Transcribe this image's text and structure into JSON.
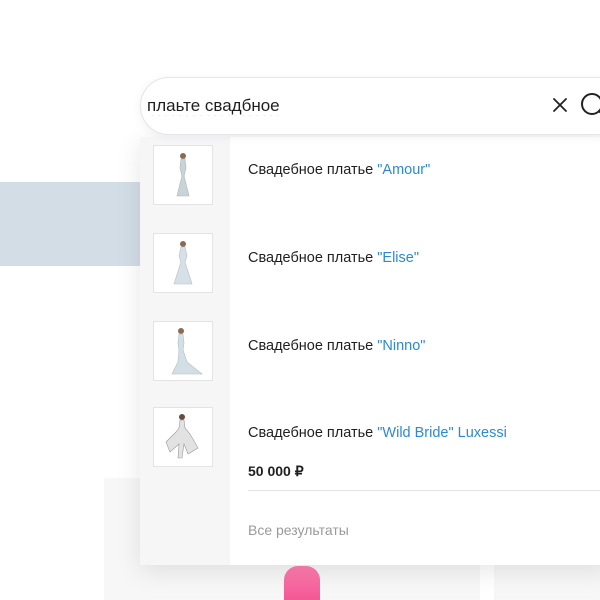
{
  "search": {
    "value": "плаьте свадбное"
  },
  "results": [
    {
      "title_prefix": "Свадебное платье ",
      "title_highlight": "\"Amour\"",
      "title_suffix": ""
    },
    {
      "title_prefix": "Свадебное платье ",
      "title_highlight": "\"Elise\"",
      "title_suffix": ""
    },
    {
      "title_prefix": "Свадебное платье ",
      "title_highlight": "\"Ninno\"",
      "title_suffix": ""
    },
    {
      "title_prefix": "Свадебное платье ",
      "title_highlight": "\"Wild Bride\" Luxessi",
      "title_suffix": "",
      "price": "50 000 ₽"
    }
  ],
  "footer": {
    "all_results_label": "Все результаты"
  },
  "colors": {
    "highlight": "#2a8ad3",
    "banner": "#d3dde6",
    "price_text": "#1f1f1f",
    "muted_text": "#9a9a9a"
  },
  "icons": {
    "clear": "close-icon",
    "search": "search-icon"
  }
}
